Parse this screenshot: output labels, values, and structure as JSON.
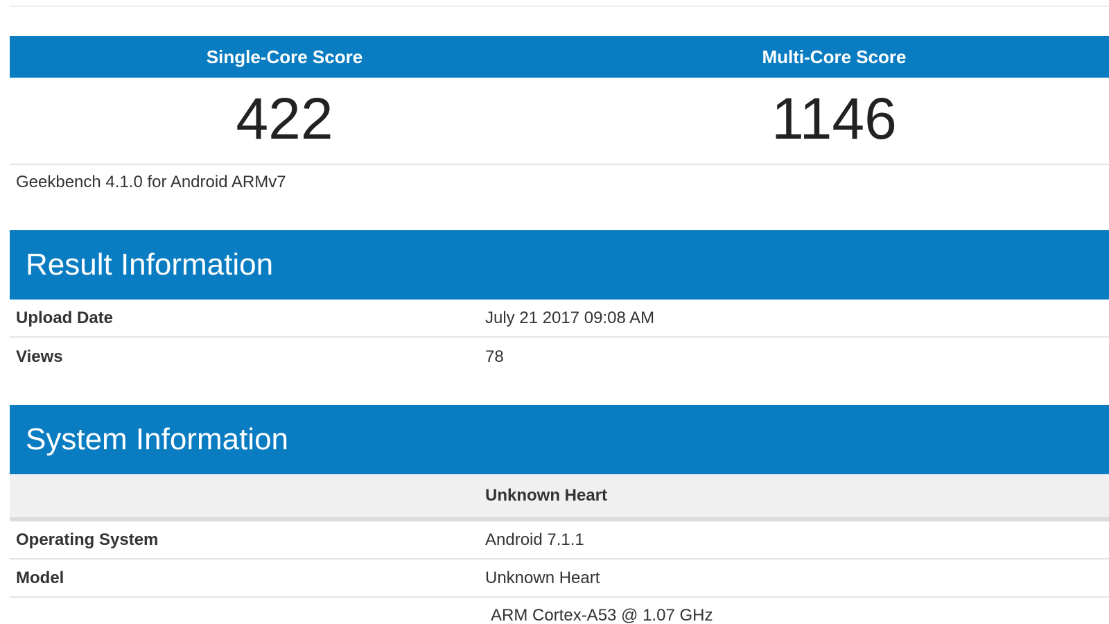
{
  "scores": {
    "single_core_label": "Single-Core Score",
    "multi_core_label": "Multi-Core Score",
    "single_core_value": "422",
    "multi_core_value": "1146",
    "benchmark_version": "Geekbench 4.1.0 for Android ARMv7"
  },
  "result_information": {
    "title": "Result Information",
    "rows": [
      {
        "label": "Upload Date",
        "value": "July 21 2017 09:08 AM"
      },
      {
        "label": "Views",
        "value": "78"
      }
    ]
  },
  "system_information": {
    "title": "System Information",
    "device_name": "Unknown Heart",
    "rows": [
      {
        "label": "Operating System",
        "value": "Android 7.1.1"
      },
      {
        "label": "Model",
        "value": "Unknown Heart"
      },
      {
        "label": "",
        "value": "ARM Cortex-A53 @ 1.07 GHz"
      }
    ]
  },
  "colors": {
    "accent": "#0a7dc2",
    "row_border": "#e3e3e3",
    "device_row_bg": "#f0f0f0"
  }
}
